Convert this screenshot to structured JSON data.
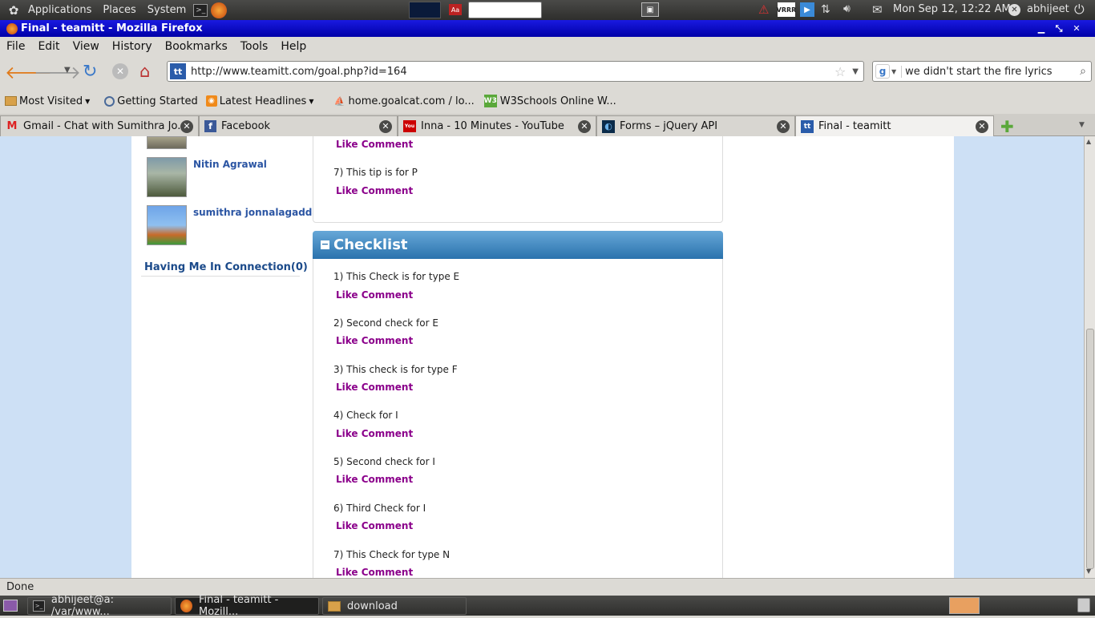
{
  "top_panel": {
    "menus": [
      "Applications",
      "Places",
      "System"
    ],
    "clock": "Mon Sep 12, 12:22 AM",
    "user": "abhijeet"
  },
  "window": {
    "title": "Final - teamitt - Mozilla Firefox"
  },
  "menubar": [
    "File",
    "Edit",
    "View",
    "History",
    "Bookmarks",
    "Tools",
    "Help"
  ],
  "navbar": {
    "url": "http://www.teamitt.com/goal.php?id=164",
    "search": "we didn't start the fire lyrics"
  },
  "bookmarks": [
    {
      "label": "Most Visited",
      "icon": "folder-icon"
    },
    {
      "label": "Getting Started",
      "icon": "page-icon"
    },
    {
      "label": "Latest Headlines",
      "icon": "rss-icon"
    },
    {
      "label": "home.goalcat.com / lo...",
      "icon": "pma-icon"
    },
    {
      "label": "W3Schools Online W...",
      "icon": "w3-icon"
    }
  ],
  "tabs": [
    {
      "label": "Gmail - Chat with Sumithra Jo..."
    },
    {
      "label": "Facebook"
    },
    {
      "label": "Inna - 10 Minutes - YouTube"
    },
    {
      "label": "Forms – jQuery API"
    },
    {
      "label": "Final - teamitt"
    }
  ],
  "sidebar": {
    "people": [
      "Nitin Agrawal",
      "sumithra jonnalagadda"
    ],
    "connection": "Having Me In Connection(0)"
  },
  "tips": {
    "first_like": "Like Comment",
    "item7": "7) This tip is for P",
    "item7_like": "Like Comment"
  },
  "checklist": {
    "title": "Checklist",
    "items": [
      {
        "text": "1) This Check is for type E",
        "action": "Like Comment"
      },
      {
        "text": "2) Second check for E",
        "action": "Like Comment"
      },
      {
        "text": "3) This check is for type F",
        "action": "Like Comment"
      },
      {
        "text": "4) Check for I",
        "action": "Like Comment"
      },
      {
        "text": "5) Second check for I",
        "action": "Like Comment"
      },
      {
        "text": "6) Third Check for I",
        "action": "Like Comment"
      },
      {
        "text": "7) This Check for type N",
        "action": "Like Comment"
      }
    ]
  },
  "status": "Done",
  "taskbar": [
    {
      "label": "abhijeet@a: /var/www..."
    },
    {
      "label": "Final - teamitt - Mozill..."
    },
    {
      "label": "download"
    }
  ]
}
